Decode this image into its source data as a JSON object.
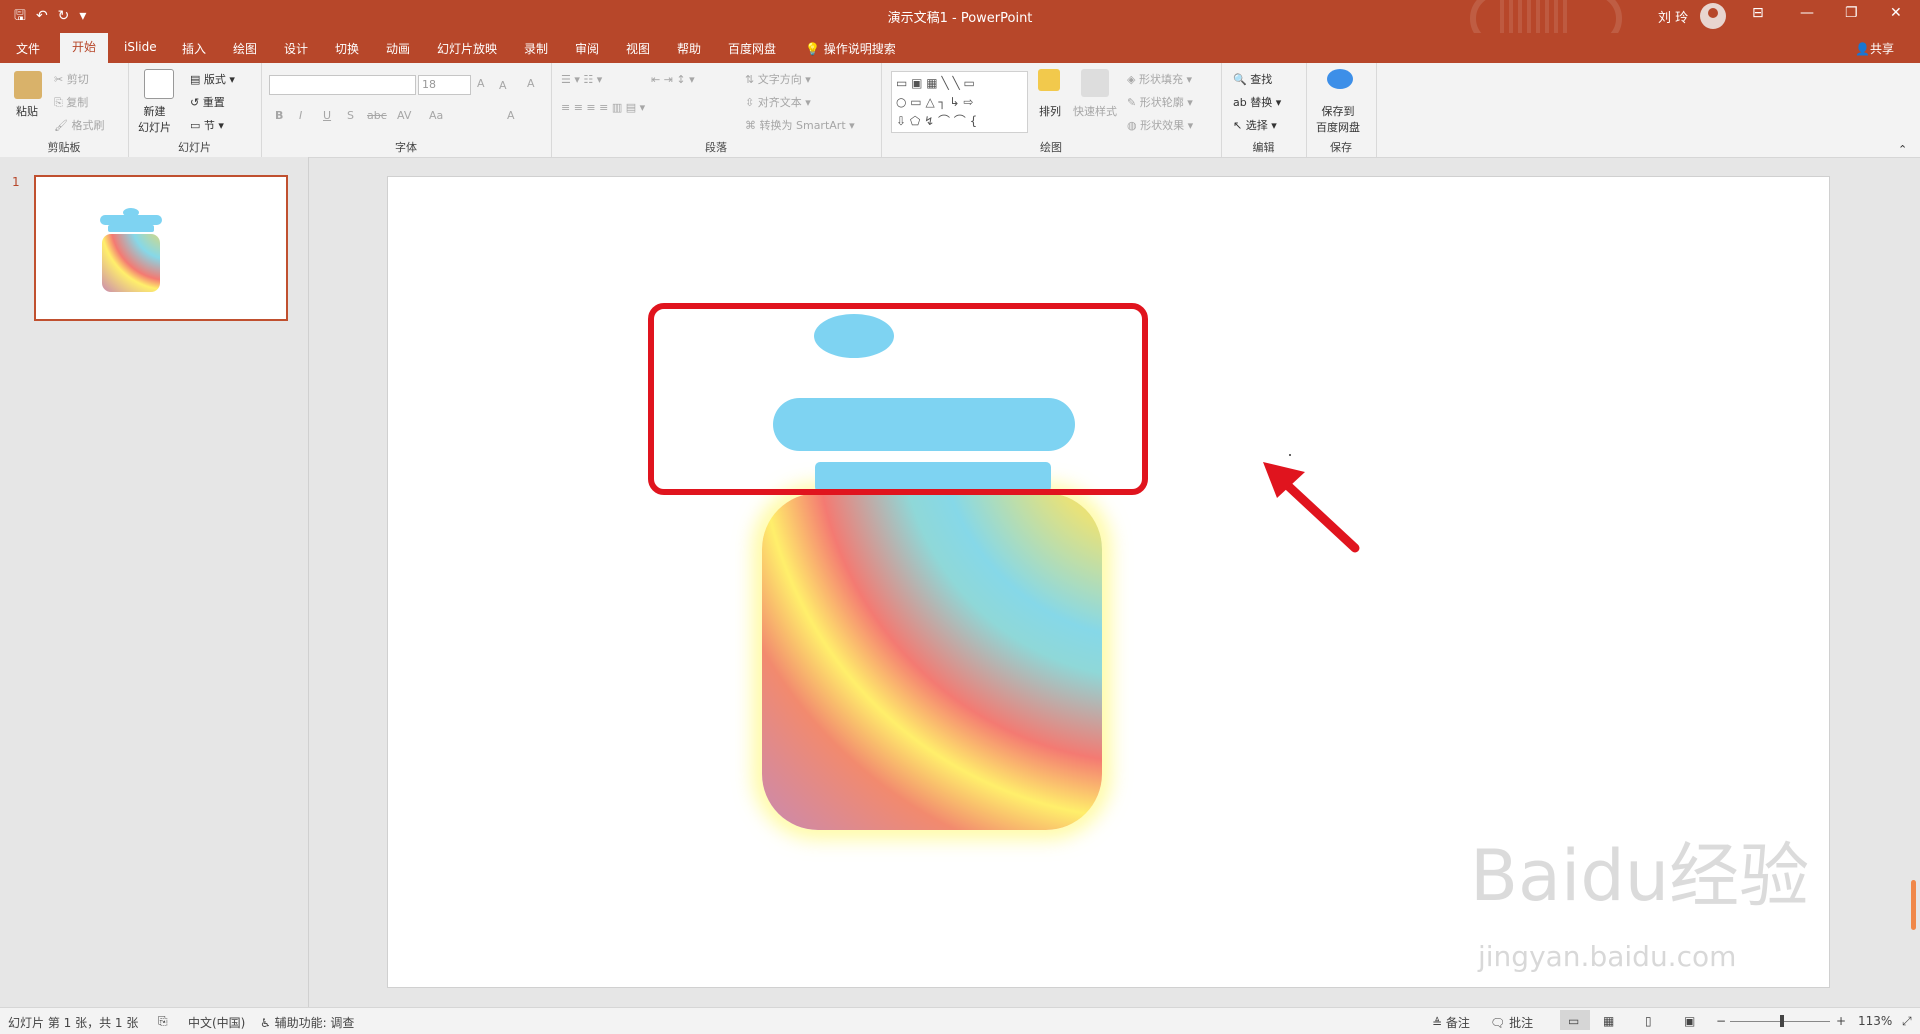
{
  "titlebar": {
    "doc_title": "演示文稿1  -  PowerPoint",
    "user_name": "刘 玲",
    "qat": {
      "save": "🖫",
      "undo": "↶",
      "redo": "↻",
      "customize": "▾"
    },
    "window": {
      "ribbon_display": "⊟",
      "minimize": "—",
      "restore": "❐",
      "close": "✕"
    }
  },
  "tabs": [
    "文件",
    "开始",
    "iSlide",
    "插入",
    "绘图",
    "设计",
    "切换",
    "动画",
    "幻灯片放映",
    "录制",
    "审阅",
    "视图",
    "帮助",
    "百度网盘"
  ],
  "tell_me": "操作说明搜索",
  "share": "共享",
  "ribbon": {
    "clipboard": {
      "label": "剪贴板",
      "paste": "粘贴",
      "cut": "剪切",
      "copy": "复制",
      "format_painter": "格式刷"
    },
    "slides": {
      "label": "幻灯片",
      "new_slide": "新建\n幻灯片",
      "layout": "版式",
      "reset": "重置",
      "section": "节"
    },
    "font": {
      "label": "字体",
      "font_name": "",
      "font_size": "18",
      "bold": "B",
      "italic": "I",
      "underline": "U",
      "shadow": "S",
      "strike": "abc",
      "spacing": "AV",
      "case": "Aa",
      "grow": "A",
      "shrink": "A",
      "clear": "A",
      "color": "A"
    },
    "paragraph": {
      "label": "段落",
      "text_direction": "文字方向",
      "align_text": "对齐文本",
      "smartart": "转换为 SmartArt"
    },
    "drawing": {
      "label": "绘图",
      "arrange": "排列",
      "quick_styles": "快速样式",
      "shape_fill": "形状填充",
      "shape_outline": "形状轮廓",
      "shape_effects": "形状效果"
    },
    "editing": {
      "label": "编辑",
      "find": "查找",
      "replace": "替换",
      "select": "选择"
    },
    "save": {
      "label": "保存",
      "save_to_baidu": "保存到\n百度网盘"
    }
  },
  "slides_panel": {
    "slide_number": "1"
  },
  "watermark": {
    "brand": "Baidu经验",
    "url": "jingyan.baidu.com"
  },
  "status": {
    "slide_info": "幻灯片 第 1 张，共 1 张",
    "language": "中文(中国)",
    "accessibility": "辅助功能: 调查",
    "notes": "备注",
    "comments": "批注",
    "zoom": "113%"
  },
  "colors": {
    "accent": "#b7472a",
    "highlight": "#e0141e",
    "jar_blue": "#7ed3f2"
  }
}
